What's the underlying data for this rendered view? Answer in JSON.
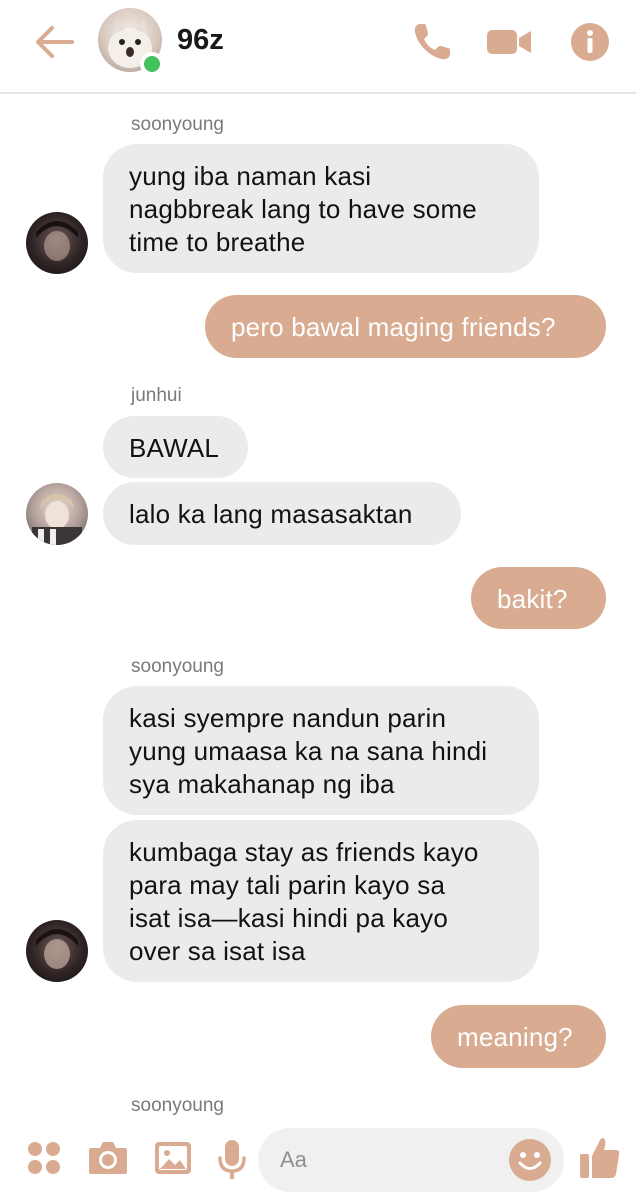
{
  "header": {
    "title": "96z",
    "back_icon": "arrow-left-icon",
    "call_icon": "phone-icon",
    "video_icon": "video-camera-icon",
    "info_icon": "info-icon",
    "accent_color": "#d9ab91",
    "online_color": "#41c25a"
  },
  "messages": {
    "m1": {
      "sender": "soonyoung",
      "text": "yung iba naman kasi\nnagbbreak lang to have some\ntime to breathe"
    },
    "m2": {
      "text": "pero bawal maging friends?"
    },
    "m3": {
      "sender": "junhui",
      "text": "BAWAL"
    },
    "m4": {
      "text": "lalo ka lang masasaktan"
    },
    "m5": {
      "text": "bakit?"
    },
    "m6": {
      "sender": "soonyoung",
      "text": "kasi syempre nandun parin\nyung umaasa ka na sana hindi\nsya makahanap ng iba"
    },
    "m7": {
      "text": "kumbaga stay as friends kayo\npara may tali parin kayo sa\nisat isa—kasi hindi pa kayo\nover sa isat isa"
    },
    "m8": {
      "text": "meaning?"
    },
    "m9": {
      "sender": "soonyoung"
    }
  },
  "composer": {
    "placeholder": "Aa",
    "menu_icon": "four-dots-icon",
    "camera_icon": "camera-icon",
    "gallery_icon": "image-icon",
    "mic_icon": "microphone-icon",
    "emoji_icon": "smiley-icon",
    "like_icon": "thumbs-up-icon"
  },
  "colors": {
    "incoming_bubble": "#ebebeb",
    "outgoing_bubble": "#d9ab91"
  }
}
